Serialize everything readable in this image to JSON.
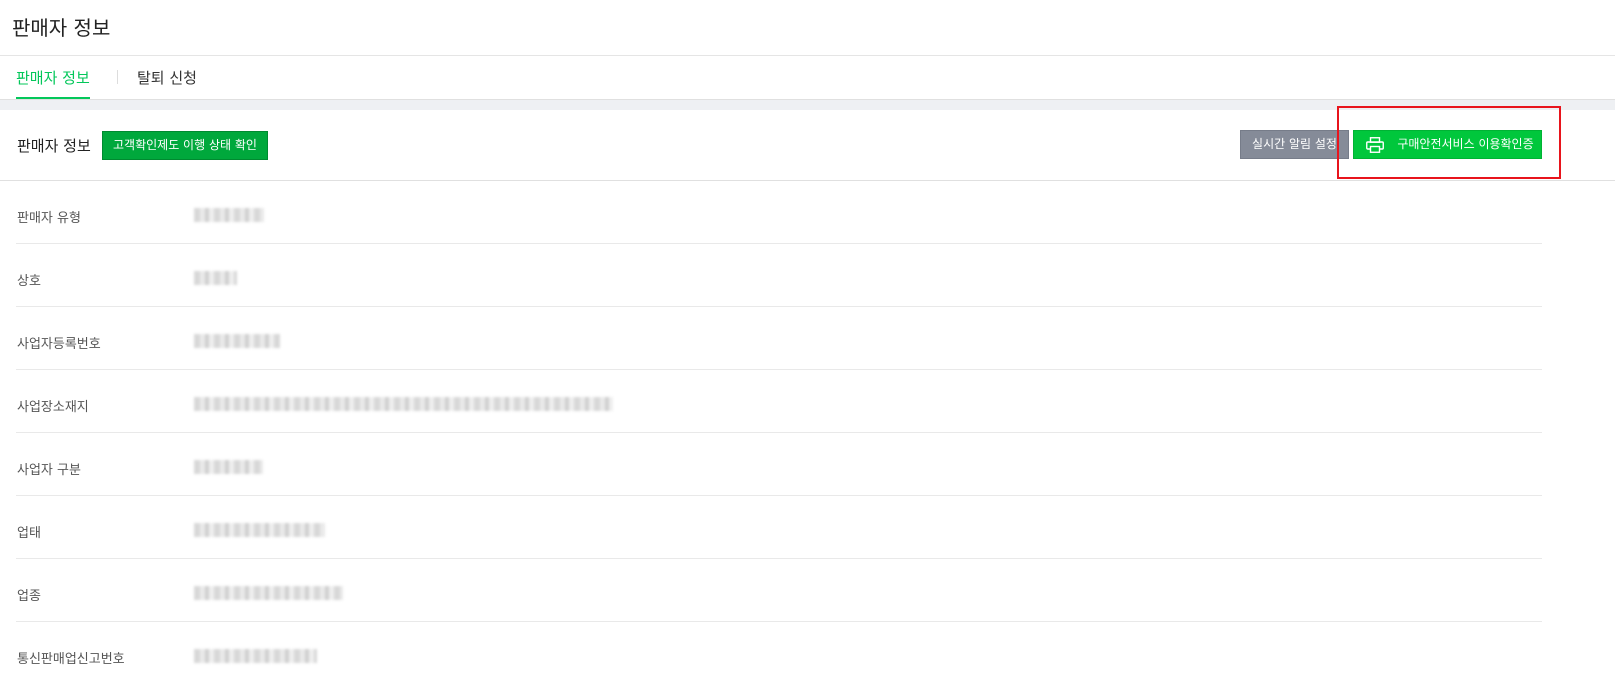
{
  "page": {
    "title": "판매자 정보"
  },
  "tabs": [
    {
      "label": "판매자 정보",
      "active": true
    },
    {
      "label": "탈퇴 신청",
      "active": false
    }
  ],
  "section": {
    "title": "판매자 정보",
    "check_button": "고객확인제도 이행 상태 확인",
    "alert_button": "실시간 알림 설정",
    "cert_button": "구매안전서비스 이용확인증"
  },
  "rows": [
    {
      "label": "판매자 유형"
    },
    {
      "label": "상호"
    },
    {
      "label": "사업자등록번호"
    },
    {
      "label": "사업장소재지"
    },
    {
      "label": "사업자 구분"
    },
    {
      "label": "업태"
    },
    {
      "label": "업종"
    },
    {
      "label": "통신판매업신고번호"
    }
  ],
  "colors": {
    "accent": "#03c75a",
    "button_green": "#00c73c",
    "button_gray": "#858b98",
    "highlight": "#e8141c"
  },
  "icons": {
    "cert_button": "printer-icon"
  }
}
